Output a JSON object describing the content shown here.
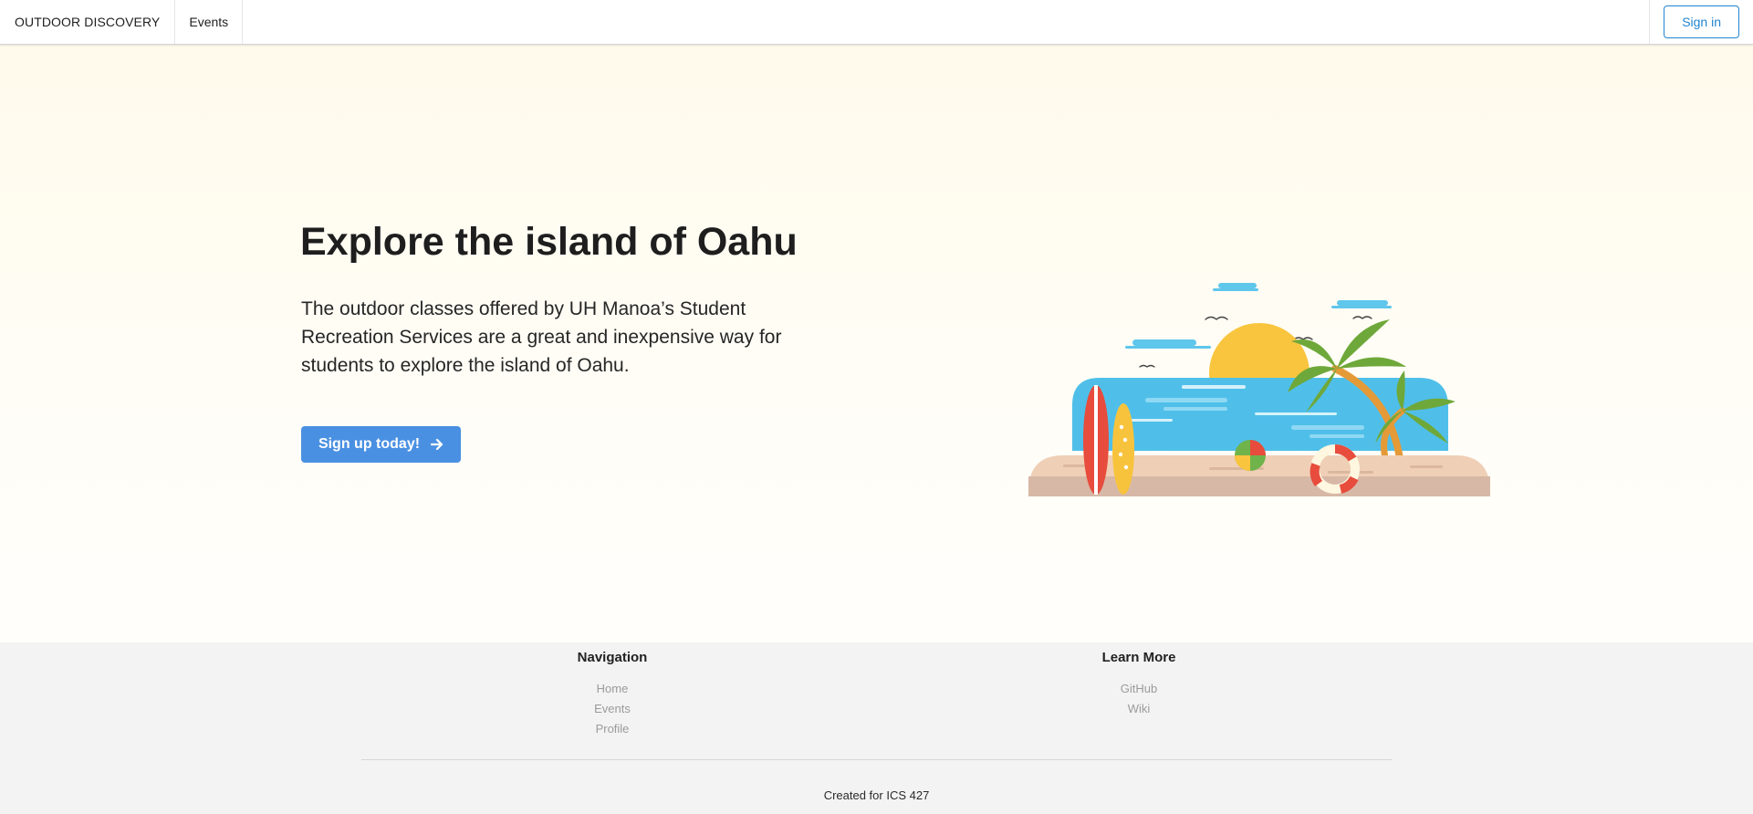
{
  "navbar": {
    "brand": "OUTDOOR DISCOVERY",
    "items": [
      {
        "label": "Events"
      }
    ],
    "signin_label": "Sign in"
  },
  "hero": {
    "title": "Explore the island of Oahu",
    "description": "The outdoor classes offered by UH Manoa’s Student Recreation Services are a great and inexpensive way for students to explore the island of Oahu.",
    "cta": {
      "label": "Sign up today!",
      "icon": "arrow-right-icon"
    },
    "illustration": {
      "icon": "beach-illustration",
      "colors": {
        "sand": "#efcfb6",
        "sand_shadow": "#d7b8a6",
        "sea": "#4fbfe9",
        "sun": "#f9c53e",
        "palm": "#6fa83a",
        "trunk": "#e59a38"
      }
    }
  },
  "footer": {
    "navigation": {
      "heading": "Navigation",
      "links": [
        "Home",
        "Events",
        "Profile"
      ]
    },
    "learn_more": {
      "heading": "Learn More",
      "links": [
        "GitHub",
        "Wiki"
      ]
    },
    "credit": "Created for ICS 427"
  },
  "colors": {
    "primary": "#4a90e2",
    "signin_blue": "#2185d0",
    "hero_bg": "#fffbf0",
    "footer_bg": "#f3f3f3"
  }
}
